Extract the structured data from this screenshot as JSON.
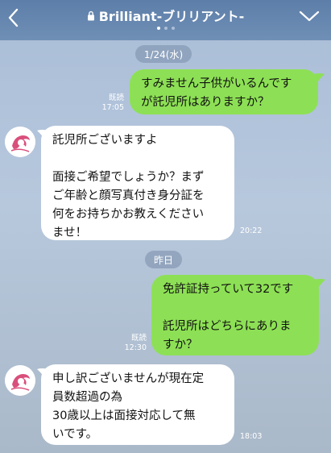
{
  "header": {
    "title": "Brilliant-ブリリアント-",
    "page_dots": 3,
    "active_dot": 0
  },
  "messages": {
    "date1": "1/24(水)",
    "m1": {
      "lines": [
        "すみません子供がいるんです",
        "が託児所はありますか？"
      ],
      "read": "既読",
      "time": "17:05"
    },
    "m2": {
      "lines": [
        "託児所ございますよ",
        "",
        "面接ご希望でしょうか？まず",
        "ご年齢と顔写真付き身分証を",
        "何をお持ちかお教えください",
        "ませ！"
      ],
      "time": "20:22"
    },
    "date2": "昨日",
    "m3": {
      "lines": [
        "免許証持っていて32です",
        "",
        "託児所はどちらにありま",
        "すか？"
      ],
      "read": "既読",
      "time": "12:30"
    },
    "m4": {
      "lines": [
        "申し訳ございませんが現在定",
        "員数超過の為",
        "30歳以上は面接対応して無",
        "いです。"
      ],
      "time": "18:03"
    }
  },
  "colors": {
    "header": "#6786b0",
    "outgoing_bubble": "#8de055",
    "incoming_bubble": "#ffffff",
    "avatar_accent": "#d94f7c"
  }
}
